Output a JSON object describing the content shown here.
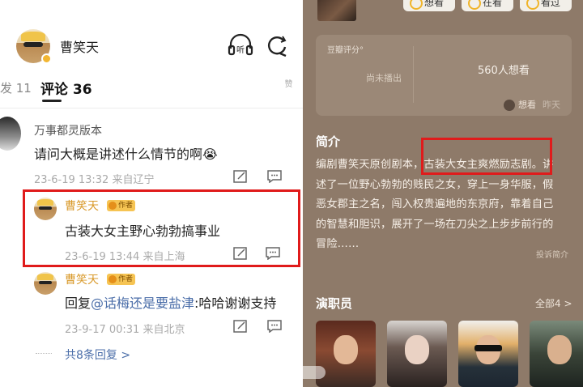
{
  "header": {
    "name": "曹笑天"
  },
  "tabs": {
    "left_partial": "发 11",
    "active": "评论 36",
    "right_partial": "赞"
  },
  "comments": [
    {
      "user": "万事都灵版本",
      "text": "请问大概是讲述什么情节的啊😭",
      "meta": "23-6-19 13:32  来自辽宁"
    }
  ],
  "replies": [
    {
      "user": "曹笑天",
      "tag": "作者",
      "text": "古装大女主野心勃勃搞事业",
      "meta": "23-6-19 13:44  来自上海"
    },
    {
      "user": "曹笑天",
      "tag": "作者",
      "text_prefix": "回复",
      "mention": "@话梅还是要盐津",
      "text_suffix": ":哈哈谢谢支持",
      "meta": "23-9-17 00:31  来自北京"
    }
  ],
  "more_replies": "共8条回复 >",
  "movie": {
    "pills": [
      "想看",
      "在看",
      "看过"
    ],
    "rating_label": "豆瓣评分°",
    "rating_value": "尚未播出",
    "want_count": "560人想看",
    "want_user": "想看",
    "want_time": "昨天",
    "intro_title": "简介",
    "intro_lines": [
      "编剧曹笑天原创剧本，古装大女主爽燃励志剧。讲",
      "述了一位野心勃勃的贱民之女，穿上一身华服，假",
      "恶女郡主之名，闯入权贵遍地的东京府，靠着自己",
      "的智慧和胆识，展开了一场在刀尖之上步步前行的",
      "冒险……"
    ],
    "intro_more": "投诉简介",
    "cast_title": "演职员",
    "cast_all": "全部4 >"
  },
  "colors": {
    "highlight": "#e01b1b",
    "right_bg": "#8e7a69",
    "author_name": "#d99a2b",
    "mention": "#4b6ea9"
  },
  "icons": [
    "listen-icon",
    "share-icon",
    "edit-icon",
    "message-icon"
  ]
}
